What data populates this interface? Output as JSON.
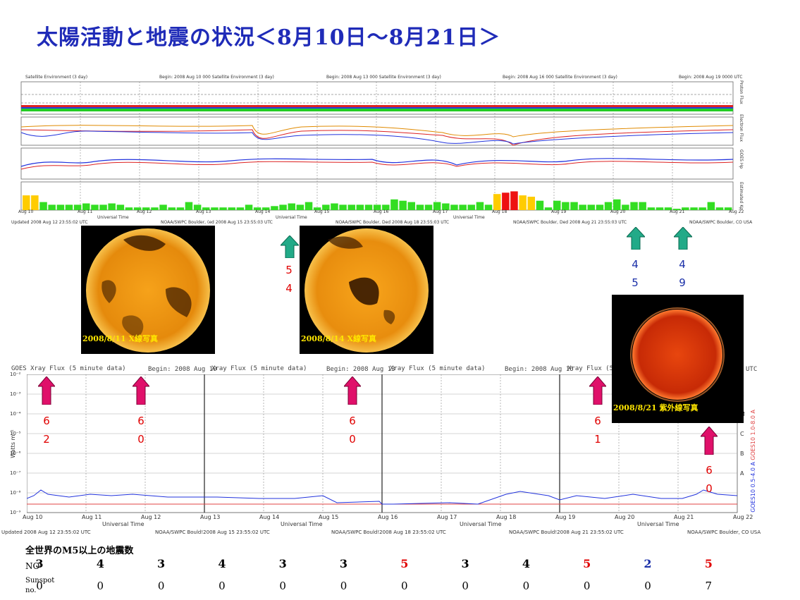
{
  "title": "太陽活動と地震の状況＜8月10日～8月21日＞",
  "goes_top": {
    "header_left": "Satellite Environment (3 day)",
    "begins": [
      "Begin: 2008 Aug 10 000 Satellite Environment (3 day)",
      "Begin: 2008 Aug 13 000 Satellite Environment (3 day)",
      "Begin: 2008 Aug 16 000 Satellite Environment (3 day)",
      "Begin: 2008 Aug 19 0000 UTC"
    ],
    "panel_labels": [
      "Proton Flux",
      "Electron Flux",
      "GOES Hp",
      "Estimated Kp"
    ],
    "date_ticks": [
      "Aug 10",
      "Aug 11",
      "Aug 12",
      "Aug 13",
      "Aug 14",
      "Aug 15",
      "Aug 16",
      "Aug 17",
      "Aug 18",
      "Aug 19",
      "Aug 20",
      "Aug 21",
      "Aug 22"
    ],
    "axis_title": "Universal Time",
    "footer": [
      "Updated 2008 Aug 12 23:55:02 UTC",
      "NOAA/SWPC Boulder, (ed 2008 Aug 15 23:55:03 UTC",
      "NOAA/SWPC Boulder, Ded 2008 Aug 18 23:55:03 UTC",
      "NOAA/SWPC Boulder, Ded 2008 Aug 21 23:55:03 UTC",
      "NOAA/SWPC Boulder, CO USA"
    ],
    "kp_levels": [
      0.55,
      0.55,
      0.3,
      0.2,
      0.2,
      0.2,
      0.2,
      0.25,
      0.2,
      0.2,
      0.25,
      0.2,
      0.1,
      0.1,
      0.1,
      0.1,
      0.2,
      0.1,
      0.1,
      0.3,
      0.2,
      0.1,
      0.1,
      0.1,
      0.1,
      0.1,
      0.2,
      0.1,
      0.1,
      0.15,
      0.2,
      0.25,
      0.2,
      0.3,
      0.1,
      0.2,
      0.25,
      0.2,
      0.2,
      0.2,
      0.2,
      0.2,
      0.2,
      0.4,
      0.35,
      0.3,
      0.2,
      0.2,
      0.3,
      0.25,
      0.2,
      0.2,
      0.2,
      0.3,
      0.2,
      0.6,
      0.65,
      0.7,
      0.55,
      0.5,
      0.35,
      0.1,
      0.35,
      0.3,
      0.3,
      0.2,
      0.2,
      0.2,
      0.3,
      0.4,
      0.2,
      0.3,
      0.3,
      0.1,
      0.1,
      0.1,
      0.05,
      0.1,
      0.1,
      0.1,
      0.3,
      0.1,
      0.1
    ]
  },
  "xray": {
    "header": [
      "GOES Xray Flux (5 minute data)",
      "Begin: 2008 Aug 10",
      "Xray Flux (5 minute data)",
      "Begin: 2008 Aug 13",
      "Xray Flux (5 minute data)",
      "Begin: 2008 Aug 16",
      "Xray Flux (5 minute data)",
      "UTC"
    ],
    "yaxis": "Watts m⁻²",
    "ytick": [
      "10⁻²",
      "10⁻³",
      "10⁻⁴",
      "10⁻⁵",
      "10⁻⁶",
      "10⁻⁷",
      "10⁻⁸",
      "10⁻⁹"
    ],
    "class_letters": [
      "X",
      "M",
      "C",
      "B",
      "A"
    ],
    "legend_red": "GOES10 1.0-8.0 A",
    "legend_blue": "GOES10 0.5-4.0 A",
    "date_ticks": [
      "Aug 10",
      "Aug 11",
      "Aug 12",
      "Aug 13",
      "Aug 14",
      "Aug 15",
      "Aug 16",
      "Aug 17",
      "Aug 18",
      "Aug 19",
      "Aug 20",
      "Aug 21",
      "Aug 22"
    ],
    "axis_title": "Universal Time",
    "footer": [
      "Updated 2008 Aug 12 23:55:02 UTC",
      "NOAA/SWPC Bould!2008 Aug 15 23:55:02 UTC",
      "NOAA/SWPC Bould!2008 Aug 18 23:55:02 UTC",
      "NOAA/SWPC Bould!2008 Aug 21 23:55:02 UTC",
      "NOAA/SWPC Boulder, CO USA"
    ]
  },
  "photos": [
    {
      "caption": "2008/8/11 X線写真"
    },
    {
      "caption": "2008/8/14 X線写真"
    },
    {
      "caption": "2008/8/21 紫外線写真"
    }
  ],
  "green_markers": [
    {
      "d1": "5",
      "d2": "4"
    },
    {
      "d1": "4",
      "d2": "5"
    },
    {
      "d1": "4",
      "d2": "9"
    }
  ],
  "pink_markers": [
    {
      "d1": "6",
      "d2": "2"
    },
    {
      "d1": "6",
      "d2": "0"
    },
    {
      "d1": "6",
      "d2": "0"
    },
    {
      "d1": "6",
      "d2": "1"
    },
    {
      "d1": "6",
      "d2": "0"
    }
  ],
  "quake_table": {
    "heading": "全世界のM5以上の地震数",
    "row1_label": "NO",
    "row2_label1": "Sunspot",
    "row2_label2": "no.",
    "counts": [
      "3",
      "4",
      "3",
      "4",
      "3",
      "3",
      "5",
      "3",
      "4",
      "5",
      "2",
      "5"
    ],
    "count_colors": [
      "#000000",
      "#000000",
      "#000000",
      "#000000",
      "#000000",
      "#000000",
      "#e00000",
      "#000000",
      "#000000",
      "#e00000",
      "#1a2fa8",
      "#e00000"
    ],
    "sunspots": [
      "0",
      "0",
      "0",
      "0",
      "0",
      "0",
      "0",
      "0",
      "0",
      "0",
      "0",
      "7"
    ]
  },
  "colors": {
    "title_blue": "#1f2bb8",
    "kp_green": "#33dd22",
    "kp_yellow": "#ffcc00",
    "kp_red": "#ee1111",
    "green_arrow": "#22aa88",
    "pink_arrow": "#e0106a",
    "value_red": "#e00000",
    "value_blue": "#1a2fa8"
  }
}
